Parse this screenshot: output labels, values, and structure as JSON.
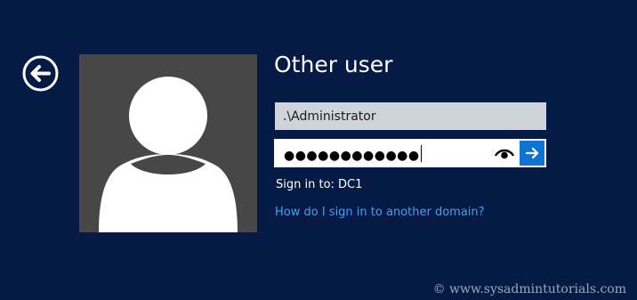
{
  "header": {
    "title": "Other user"
  },
  "login": {
    "username_value": ".\\Administrator",
    "password_masked": "●●●●●●●●●●●●",
    "sign_in_to_label": "Sign in to:",
    "sign_in_to_value": "DC1",
    "domain_help_link": "How do I sign in to another domain?"
  },
  "icons": {
    "back": "back-arrow-icon",
    "avatar": "user-silhouette-icon",
    "reveal": "eye-icon",
    "submit": "right-arrow-icon"
  },
  "colors": {
    "background": "#051a44",
    "avatar_tile": "#474747",
    "submit_accent": "#0d74d6",
    "link": "#3fa3f5"
  },
  "watermark": "© www.sysadmintutorials.com"
}
